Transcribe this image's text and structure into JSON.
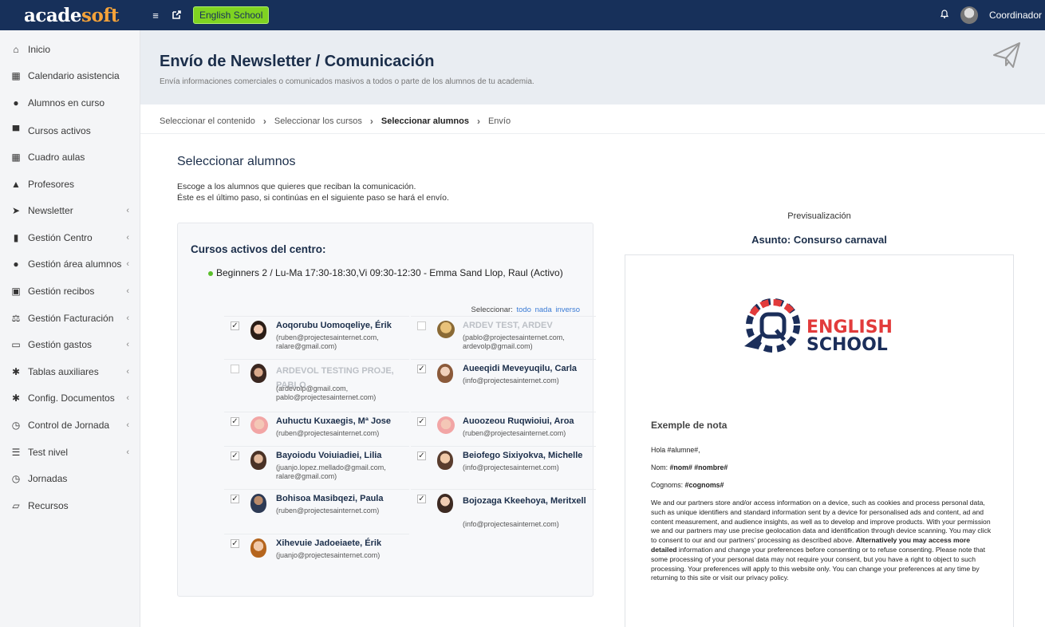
{
  "topbar": {
    "logo_a": "acade",
    "logo_b": "soft",
    "school": "English School",
    "user": "Coordinador"
  },
  "sidebar": {
    "items": [
      {
        "label": "Inicio",
        "icon": "home-icon",
        "submenu": false
      },
      {
        "label": "Calendario asistencia",
        "icon": "calendar-icon",
        "submenu": false
      },
      {
        "label": "Alumnos en curso",
        "icon": "user-icon",
        "submenu": false
      },
      {
        "label": "Cursos activos",
        "icon": "desk-icon",
        "submenu": false
      },
      {
        "label": "Cuadro aulas",
        "icon": "grid-icon",
        "submenu": false
      },
      {
        "label": "Profesores",
        "icon": "graduation-cap-icon",
        "submenu": false
      },
      {
        "label": "Newsletter",
        "icon": "paper-plane-icon",
        "submenu": true
      },
      {
        "label": "Gestión Centro",
        "icon": "building-icon",
        "submenu": true
      },
      {
        "label": "Gestión área alumnos",
        "icon": "user-icon",
        "submenu": true
      },
      {
        "label": "Gestión recibos",
        "icon": "money-icon",
        "submenu": true
      },
      {
        "label": "Gestión Facturación",
        "icon": "scale-icon",
        "submenu": true
      },
      {
        "label": "Gestión gastos",
        "icon": "credit-card-icon",
        "submenu": true
      },
      {
        "label": "Tablas auxiliares",
        "icon": "cog-icon",
        "submenu": true
      },
      {
        "label": "Config. Documentos",
        "icon": "cog-icon",
        "submenu": true
      },
      {
        "label": "Control de Jornada",
        "icon": "clock-icon",
        "submenu": true
      },
      {
        "label": "Test nivel",
        "icon": "list-icon",
        "submenu": true
      },
      {
        "label": "Jornadas",
        "icon": "clock-icon",
        "submenu": false
      },
      {
        "label": "Recursos",
        "icon": "folder-icon",
        "submenu": false
      }
    ]
  },
  "header": {
    "title": "Envío de Newsletter / Comunicación",
    "subtitle": "Envía informaciones comerciales o comunicados masivos a todos o parte de los alumnos de tu academia."
  },
  "breadcrumb": {
    "steps": [
      "Seleccionar el contenido",
      "Seleccionar los cursos",
      "Seleccionar alumnos",
      "Envío"
    ]
  },
  "section": {
    "title": "Seleccionar alumnos",
    "desc1": "Escoge a los alumnos que quieres que reciban la comunicación.",
    "desc2": "Éste es el último paso, si continúas en el siguiente paso se hará el envío."
  },
  "courses": {
    "title": "Cursos activos del centro:",
    "course": "Beginners 2 / Lu-Ma 17:30-18:30,Vi 09:30-12:30 - Emma Sand Llop, Raul (Activo)",
    "select_label": "Seleccionar:",
    "select_all": "todo",
    "select_none": "nada",
    "select_invert": "inverso",
    "students": [
      {
        "name": "Aoqorubu Uomoqeliye, Érik",
        "email": "(ruben@projectesainternet.com, ralare@gmail.com)",
        "checked": true,
        "disabled": false
      },
      {
        "name": "ARDEV TEST, ARDEV",
        "email": "(pablo@projectesainternet.com, ardevolp@gmail.com)",
        "checked": false,
        "disabled": true
      },
      {
        "name": "ARDEVOL TESTING PROJE, PABLO",
        "email": "(ardevolp@gmail.com, pablo@projectesainternet.com)",
        "checked": false,
        "disabled": true
      },
      {
        "name": "Aueeqidi Meveyuqilu, Carla",
        "email": "(info@projectesainternet.com)",
        "checked": true,
        "disabled": false
      },
      {
        "name": "Auhuctu Kuxaegis, Mª Jose",
        "email": "(ruben@projectesainternet.com)",
        "checked": true,
        "disabled": false
      },
      {
        "name": "Auoozeou Ruqwioiui, Aroa",
        "email": "(ruben@projectesainternet.com)",
        "checked": true,
        "disabled": false
      },
      {
        "name": "Bayoiodu Voiuiadiei, Lilia",
        "email": "(juanjo.lopez.mellado@gmail.com, ralare@gmail.com)",
        "checked": true,
        "disabled": false
      },
      {
        "name": "Beiofego Sixiyokva, Michelle",
        "email": "(info@projectesainternet.com)",
        "checked": true,
        "disabled": false
      },
      {
        "name": "Bohisoa Masibqezi, Paula",
        "email": "(ruben@projectesainternet.com)",
        "checked": true,
        "disabled": false
      },
      {
        "name": "Bojozaga Kkeehoya, Meritxell",
        "email": "(info@projectesainternet.com)",
        "checked": true,
        "disabled": false
      },
      {
        "name": "Xihevuie Jadoeiaete, Érik",
        "email": "(juanjo@projectesainternet.com)",
        "checked": true,
        "disabled": false
      }
    ]
  },
  "preview": {
    "label": "Previsualización",
    "subject_label": "Asunto:",
    "subject": "Consurso carnaval",
    "logo_line1": "ENGLISH",
    "logo_line2": "SCHOOL",
    "nota_title": "Exemple de nota",
    "greeting": "Hola #alumne#,",
    "nom_label": "Nom:",
    "nom_value": "#nom# #nombre#",
    "cognoms_label": "Cognoms:",
    "cognoms_value": "#cognoms#",
    "body_a": "We and our partners store and/or access information on a device, such as cookies and process personal data, such as unique identifiers and standard information sent by a device for personalised ads and content, ad and content measurement, and audience insights, as well as to develop and improve products. With your permission we and our partners may use precise geolocation data and identification through device scanning. You may click to consent to our and our partners' processing as described above. ",
    "body_bold": "Alternatively you may access more detailed",
    "body_b": " information and change your preferences before consenting or to refuse consenting. Please note that some processing of your personal data may not require your consent, but you have a right to object to such processing. Your preferences will apply to this website only. You can change your preferences at any time by returning to this site or visit our privacy policy."
  },
  "colors": {
    "topbar": "#17305a",
    "accent_green": "#7fd321",
    "logo_orange": "#f3a23a",
    "title_navy": "#1b2e4a",
    "link_blue": "#3a7bd5"
  }
}
